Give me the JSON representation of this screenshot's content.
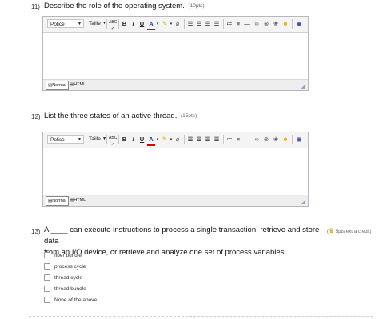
{
  "questions": [
    {
      "number": "11)",
      "text": "Describe the role of the operating system.",
      "points": "(10pts)",
      "editor": {
        "font": "Police",
        "size": "Taille",
        "mode_normal": "Normal",
        "mode_html": "HTML"
      }
    },
    {
      "number": "12)",
      "text": "List the three states of an active thread.",
      "points": "(15pts)",
      "editor": {
        "font": "Police",
        "size": "Taille",
        "mode_normal": "Normal",
        "mode_html": "HTML"
      }
    },
    {
      "number": "13)",
      "text_line1": "A ____ can execute instructions to process a single transaction, retrieve and store data",
      "text_line2": "from an I/O device, or retrieve and analyze one set of process variables.",
      "extra_credit": "5pts extra credit)",
      "options": [
        "fiber bundle",
        "process cycle",
        "thread cycle",
        "thread bundle",
        "None of the above"
      ]
    }
  ],
  "toolbar_icons": [
    "spellcheck-icon",
    "bold-icon",
    "italic-icon",
    "underline-icon",
    "font-color-icon",
    "highlight-icon",
    "eraser-icon",
    "align-left-icon",
    "align-center-icon",
    "align-right-icon",
    "align-justify-icon",
    "numbered-list-icon",
    "bulleted-list-icon",
    "horizontal-rule-icon",
    "link-icon",
    "unlink-icon",
    "image-icon",
    "emoticon-icon",
    "media-icon"
  ],
  "toolbar_glyphs": {
    "bold": "B",
    "italic": "I",
    "underline": "U",
    "font_color": "A"
  }
}
